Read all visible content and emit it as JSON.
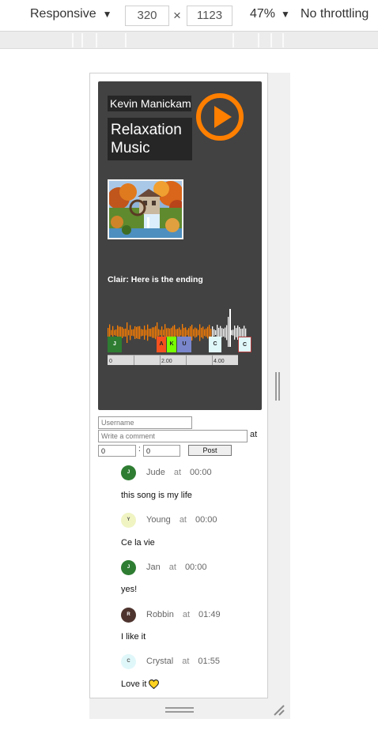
{
  "devtools": {
    "device": "Responsive",
    "width": "320",
    "times": "×",
    "height": "1123",
    "zoom": "47%",
    "throttling": "No throttling"
  },
  "player": {
    "artist": "Kevin Manickam",
    "track_title": "Relaxation Music",
    "caption": "Clair: Here is the ending",
    "accent_color": "#ff7f00",
    "markers": [
      {
        "letter": "J",
        "color": "#2e7d32",
        "text_color": "#ffffff"
      },
      {
        "letter": "A",
        "color": "#f4511e",
        "text_color": "#222222"
      },
      {
        "letter": "K",
        "color": "#76ff03",
        "text_color": "#222222"
      },
      {
        "letter": "U",
        "color": "#7986cb",
        "text_color": "#222222"
      },
      {
        "letter": "C",
        "color": "#e0f7fa",
        "text_color": "#222222"
      },
      {
        "letter": "C",
        "color": "#e0f7fa",
        "text_color": "#222222"
      }
    ],
    "timeline_labels": [
      "0",
      "2.00",
      "4.00"
    ]
  },
  "form": {
    "username_placeholder": "Username",
    "comment_placeholder": "Write a comment",
    "at_label": "at",
    "minutes_value": "0",
    "colon": ":",
    "seconds_value": "0",
    "post_label": "Post"
  },
  "comments": [
    {
      "initial": "J",
      "avatar_color": "#2e7d32",
      "avatar_text": "#ffffff",
      "name": "Jude",
      "at": "at",
      "time": "00:00",
      "text": "this song is my life",
      "emoji": ""
    },
    {
      "initial": "Y",
      "avatar_color": "#f0f4c3",
      "avatar_text": "#555555",
      "name": "Young",
      "at": "at",
      "time": "00:00",
      "text": "Ce la vie",
      "emoji": ""
    },
    {
      "initial": "J",
      "avatar_color": "#2e7d32",
      "avatar_text": "#ffffff",
      "name": "Jan",
      "at": "at",
      "time": "00:00",
      "text": "yes!",
      "emoji": ""
    },
    {
      "initial": "R",
      "avatar_color": "#4e342e",
      "avatar_text": "#ffffff",
      "name": "Robbin",
      "at": "at",
      "time": "01:49",
      "text": "I like it",
      "emoji": ""
    },
    {
      "initial": "C",
      "avatar_color": "#e0f7fa",
      "avatar_text": "#555555",
      "name": "Crystal",
      "at": "at",
      "time": "01:55",
      "text": "Love it",
      "emoji": "yellow-heart-icon"
    }
  ]
}
